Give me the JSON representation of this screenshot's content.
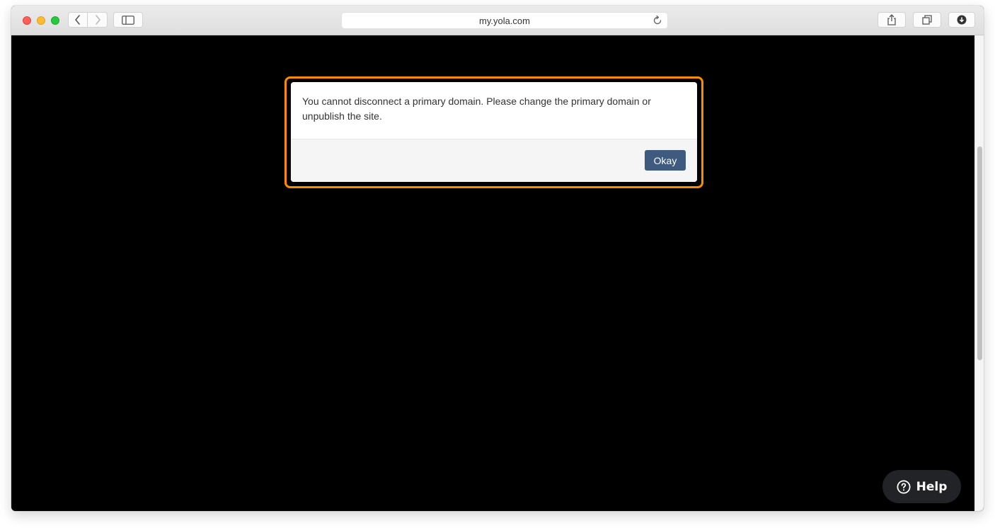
{
  "browser": {
    "url": "my.yola.com",
    "icons": {
      "back": "chevron-left-icon",
      "forward": "chevron-right-icon",
      "sidebar": "sidebar-icon",
      "reload": "reload-icon",
      "share": "share-icon",
      "tabs": "tabs-icon",
      "download": "download-icon"
    }
  },
  "dialog": {
    "message": "You cannot disconnect a primary domain. Please change the primary domain or unpublish the site.",
    "okay_label": "Okay"
  },
  "help": {
    "label": "Help",
    "icon": "question-circle-icon"
  },
  "colors": {
    "highlight": "#fb8c00",
    "button": "#3e5a7e",
    "help_bg": "#222327"
  }
}
